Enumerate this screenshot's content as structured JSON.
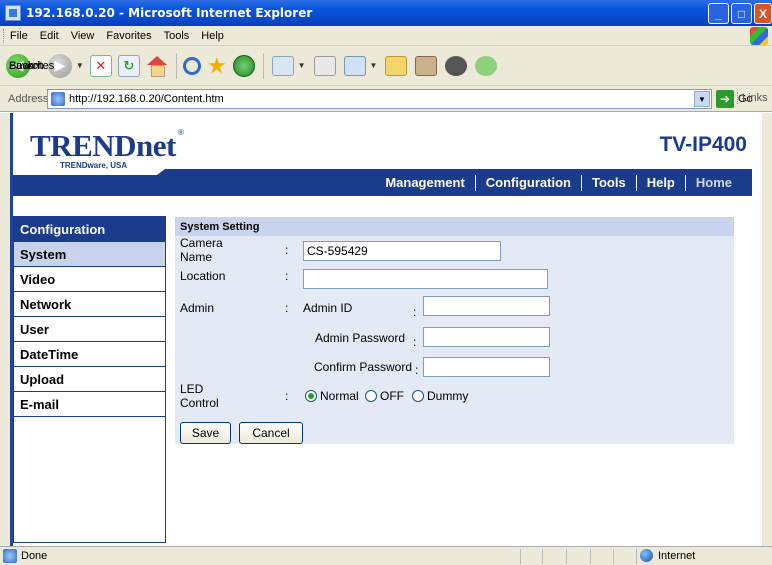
{
  "window": {
    "title": "192.168.0.20 - Microsoft Internet Explorer",
    "buttons": [
      "_",
      "□",
      "X"
    ]
  },
  "menu": [
    "File",
    "Edit",
    "View",
    "Favorites",
    "Tools",
    "Help"
  ],
  "toolbar": {
    "back_label": "Back",
    "search_label": "Search",
    "favorites_label": "Favorites"
  },
  "address": {
    "label": "Address",
    "url": "http://192.168.0.20/Content.htm",
    "go_label": "Go",
    "links_label": "Links"
  },
  "header": {
    "brand": "TRENDnet",
    "sub": "TRENDware, USA",
    "model": "TV-IP400"
  },
  "nav": [
    "Management",
    "Configuration",
    "Tools",
    "Help",
    "Home"
  ],
  "sidebar": {
    "title": "Configuration",
    "items": [
      {
        "label": "System",
        "active": true
      },
      {
        "label": "Video",
        "active": false
      },
      {
        "label": "Network",
        "active": false
      },
      {
        "label": "User",
        "active": false
      },
      {
        "label": "DateTime",
        "active": false
      },
      {
        "label": "Upload",
        "active": false
      },
      {
        "label": "E-mail",
        "active": false
      }
    ]
  },
  "form": {
    "title": "System Setting",
    "camera_name_label": "Camera Name",
    "camera_name_value": "CS-595429",
    "location_label": "Location",
    "location_value": "",
    "admin_label": "Admin",
    "admin_id_label": "Admin ID",
    "admin_id_value": "",
    "admin_password_label": "Admin Password",
    "confirm_password_label": "Confirm Password",
    "led_label": "LED Control",
    "led_options": [
      "Normal",
      "OFF",
      "Dummy"
    ],
    "led_selected": "Normal",
    "colon": ":",
    "save_label": "Save",
    "cancel_label": "Cancel"
  },
  "status": {
    "text": "Done",
    "zone": "Internet"
  },
  "colors": {
    "brand_blue": "#1b3c8c",
    "panel_bg": "#e4e9f6",
    "active_item": "#c9d2ec"
  }
}
